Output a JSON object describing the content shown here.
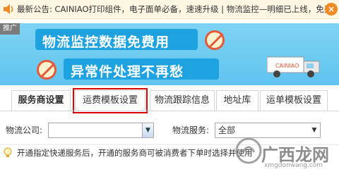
{
  "notice": {
    "text": "最新公告: CAINIAO打印组件，电子面单必备，速速升级 | 物流监控—明细已上线，免费"
  },
  "promo": {
    "tag": "推广",
    "headline_1": "物流监控数据免费用",
    "headline_2": "异常件处理不再愁"
  },
  "tabs": [
    {
      "label": "服务商设置"
    },
    {
      "label": "运费模板设置"
    },
    {
      "label": "物流跟踪信息"
    },
    {
      "label": "地址库"
    },
    {
      "label": "运单模板设置"
    }
  ],
  "form": {
    "company_label": "物流公司:",
    "company_value": "",
    "service_label": "物流服务:",
    "service_value": "全部"
  },
  "tip": {
    "text": "开通指定快递服务后，开通的服务商可被消费者下单时选择并使用"
  },
  "watermark": {
    "text": "广西龙网",
    "sub": "xmgdonwang.com"
  },
  "colors": {
    "highlight": "#d60000",
    "banner": "#5fc4ee",
    "notice_bg": "#fdf6e3",
    "close": "#f08a24"
  }
}
